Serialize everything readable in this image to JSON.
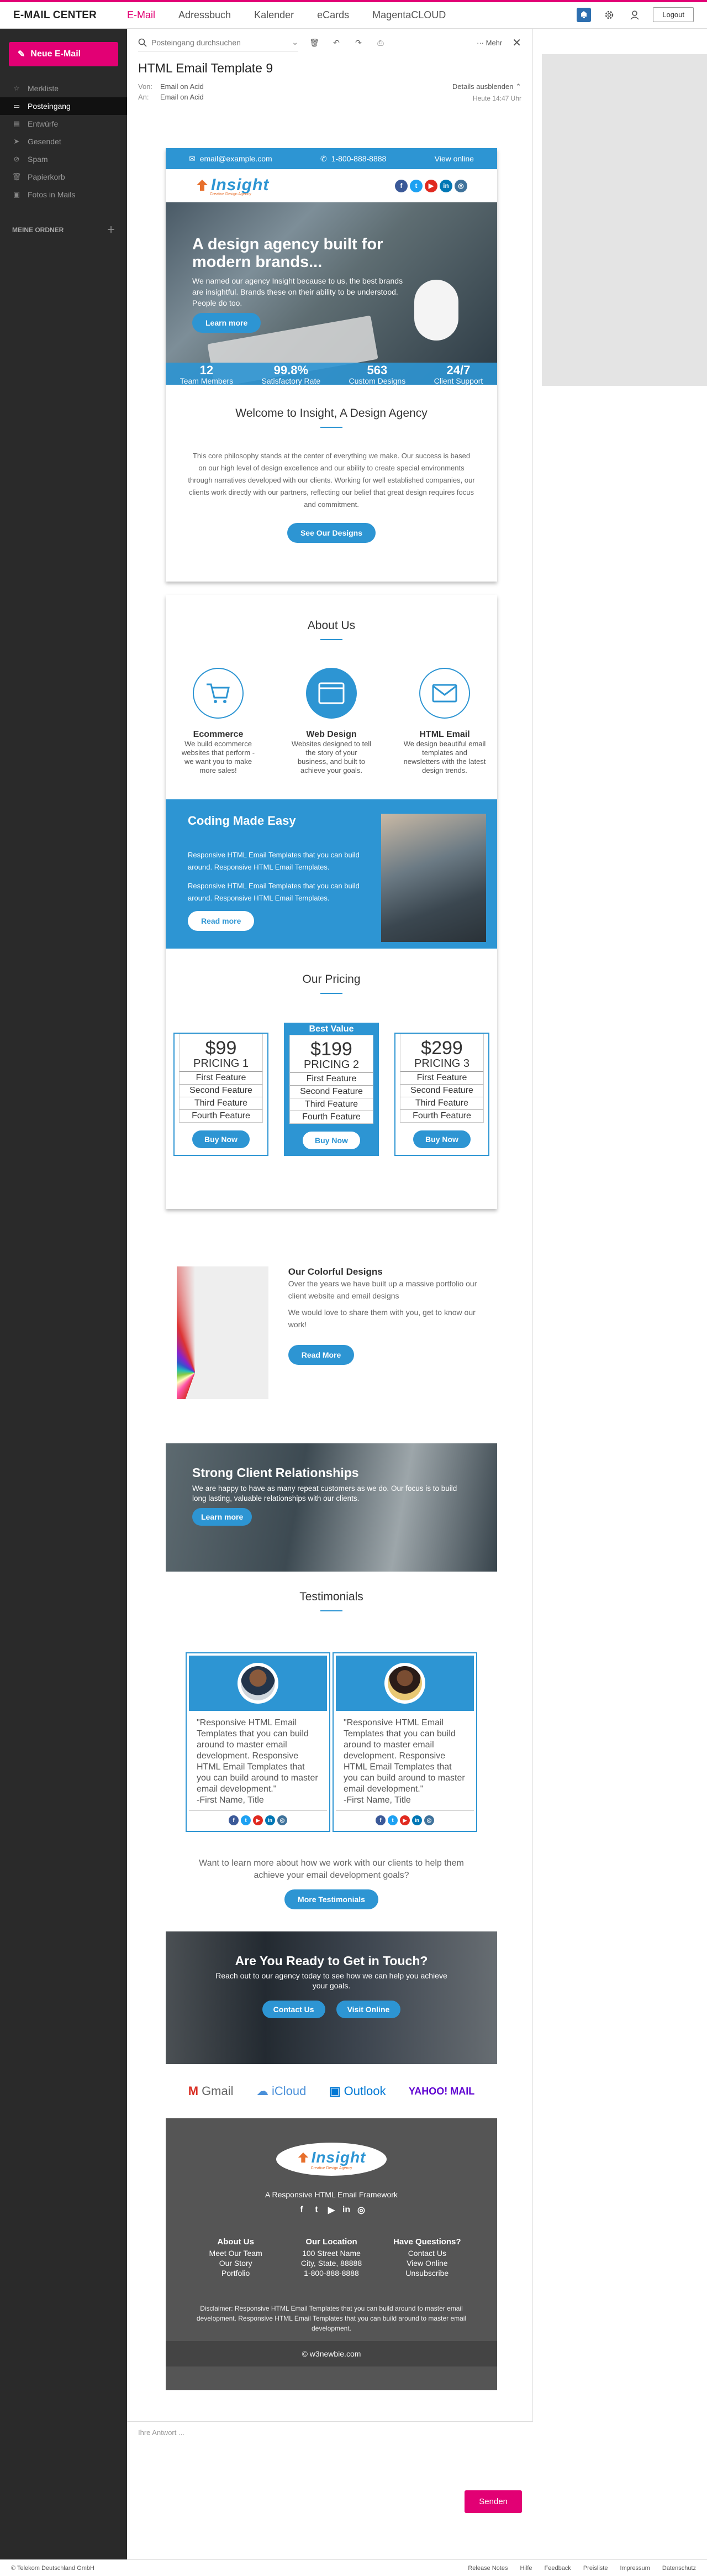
{
  "app": {
    "brand": "E-MAIL CENTER",
    "nav": [
      "E-Mail",
      "Adressbuch",
      "Kalender",
      "eCards",
      "MagentaCLOUD"
    ],
    "logout": "Logout"
  },
  "sidebar": {
    "new_mail": "Neue E-Mail",
    "items": [
      {
        "label": "Merkliste",
        "icon": "star-icon"
      },
      {
        "label": "Posteingang",
        "icon": "inbox-icon"
      },
      {
        "label": "Entwürfe",
        "icon": "draft-icon"
      },
      {
        "label": "Gesendet",
        "icon": "sent-icon"
      },
      {
        "label": "Spam",
        "icon": "spam-icon"
      },
      {
        "label": "Papierkorb",
        "icon": "trash-icon"
      },
      {
        "label": "Fotos in Mails",
        "icon": "photo-icon"
      }
    ],
    "folders_label": "MEINE ORDNER"
  },
  "toolbar": {
    "search_placeholder": "Posteingang durchsuchen",
    "more": "Mehr"
  },
  "message": {
    "subject": "HTML Email Template 9",
    "from_label": "Von:",
    "from": "Email on Acid",
    "to_label": "An:",
    "to": "Email on Acid",
    "details": "Details ausblenden",
    "date": "Heute 14:47 Uhr"
  },
  "email": {
    "header": {
      "email": "email@example.com",
      "phone": "1-800-888-8888",
      "view_online": "View online"
    },
    "logo": {
      "name": "Insight",
      "sub": "Creative Design Agency"
    },
    "hero": {
      "title": "A design agency built for modern brands...",
      "text": "We named our agency Insight because to us, the best brands are insightful. Brands these on their ability to be understood. People do too.",
      "button": "Learn more"
    },
    "stats": [
      {
        "n": "12",
        "l": "Team Members"
      },
      {
        "n": "99.8%",
        "l": "Satisfactory Rate"
      },
      {
        "n": "563",
        "l": "Custom Designs"
      },
      {
        "n": "24/7",
        "l": "Client Support"
      }
    ],
    "welcome": {
      "title": "Welcome to Insight, A Design Agency",
      "text": "This core philosophy stands at the center of everything we make. Our success is based on our high level of design excellence and our ability to create special environments through narratives developed with our clients. Working for well established companies, our clients work directly with our partners, reflecting our belief that great design requires focus and commitment.",
      "button": "See Our Designs"
    },
    "about": {
      "title": "About Us",
      "features": [
        {
          "title": "Ecommerce",
          "text": "We build ecommerce websites that perform - we want you to make more sales!",
          "icon": "cart-icon"
        },
        {
          "title": "Web Design",
          "text": "Websites designed to tell the story of your business, and built to achieve your goals.",
          "icon": "browser-icon"
        },
        {
          "title": "HTML Email",
          "text": "We design beautiful email templates and newsletters with the latest design trends.",
          "icon": "envelope-icon"
        }
      ]
    },
    "coding": {
      "title": "Coding Made Easy",
      "p1": "Responsive HTML Email Templates that you can build around. Responsive HTML Email Templates.",
      "p2": "Responsive HTML Email Templates that you can build around. Responsive HTML Email Templates.",
      "button": "Read more"
    },
    "pricing": {
      "title": "Our Pricing",
      "best": "Best Value",
      "plans": [
        {
          "price": "$99",
          "name": "PRICING 1",
          "features": [
            "First Feature",
            "Second Feature",
            "Third Feature",
            "Fourth Feature"
          ],
          "button": "Buy Now"
        },
        {
          "price": "$199",
          "name": "PRICING 2",
          "features": [
            "First Feature",
            "Second Feature",
            "Third Feature",
            "Fourth Feature"
          ],
          "button": "Buy Now"
        },
        {
          "price": "$299",
          "name": "PRICING 3",
          "features": [
            "First Feature",
            "Second Feature",
            "Third Feature",
            "Fourth Feature"
          ],
          "button": "Buy Now"
        }
      ]
    },
    "colorful": {
      "title": "Our Colorful Designs",
      "p1": "Over the years we have built up a massive portfolio our client website and email designs",
      "p2": "We would love to share them with you, get to know our work!",
      "button": "Read More"
    },
    "strong": {
      "title": "Strong Client Relationships",
      "text": "We are happy to have as many repeat customers as we do. Our focus is to build long lasting, valuable relationships with our clients.",
      "button": "Learn more"
    },
    "testimonials": {
      "title": "Testimonials",
      "cards": [
        {
          "quote": "\"Responsive HTML Email Templates that you can build around to master email development. Responsive HTML Email Templates that you can build around to master email development.\"",
          "name": "-First Name, Title"
        },
        {
          "quote": "\"Responsive HTML Email Templates that you can build around to master email development. Responsive HTML Email Templates that you can build around to master email development.\"",
          "name": "-First Name, Title"
        }
      ],
      "more_text": "Want to learn more about how we work with our clients to help them achieve your email development goals?",
      "button": "More Testimonials"
    },
    "touch": {
      "title": "Are You Ready to Get in Touch?",
      "text": "Reach out to our agency today to see how we can help you achieve your goals.",
      "contact": "Contact Us",
      "visit": "Visit Online"
    },
    "clients": [
      "Gmail",
      "iCloud",
      "Outlook",
      "YAHOO! MAIL"
    ],
    "footer": {
      "tagline": "A Responsive HTML Email Framework",
      "cols": [
        {
          "title": "About Us",
          "lines": [
            "Meet Our Team",
            "Our Story",
            "Portfolio"
          ]
        },
        {
          "title": "Our Location",
          "lines": [
            "100 Street Name",
            "City, State, 88888",
            "1-800-888-8888"
          ]
        },
        {
          "title": "Have Questions?",
          "lines": [
            "Contact Us",
            "View Online",
            "Unsubscribe"
          ]
        }
      ],
      "disclaimer": "Disclaimer: Responsive HTML Email Templates that you can build around to master email development. Responsive HTML Email Templates that you can build around to master email development.",
      "copyright": "© w3newbie.com"
    }
  },
  "reply": {
    "placeholder": "Ihre Antwort ...",
    "send": "Senden"
  },
  "status": {
    "company": "© Telekom Deutschland GmbH",
    "links": [
      "Release Notes",
      "Hilfe",
      "Feedback",
      "Preisliste",
      "Impressum",
      "Datenschutz"
    ]
  },
  "colors": {
    "magenta": "#e20074",
    "accent_blue": "#2d95d3",
    "sidebar": "#2a2a2a"
  }
}
